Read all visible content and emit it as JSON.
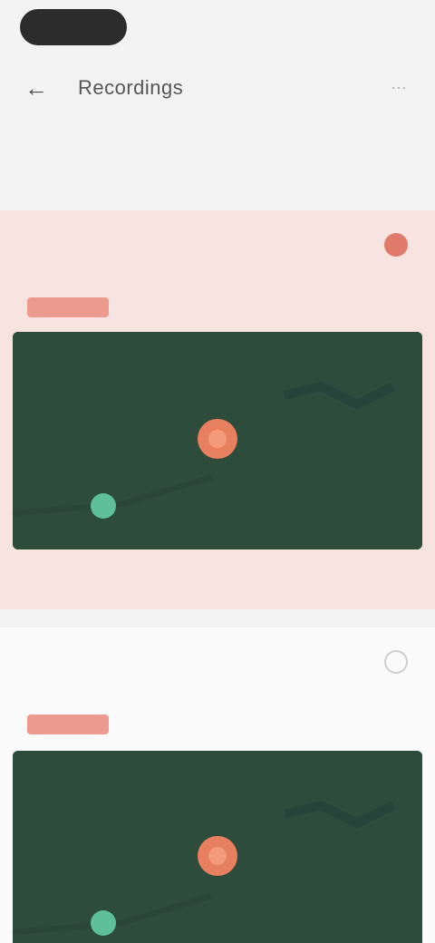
{
  "header": {
    "title": "Recordings",
    "back_icon": "back-arrow-icon",
    "more_icon": "more-icon"
  },
  "subtitle": "",
  "cards": [
    {
      "name": "",
      "meta_left": "",
      "meta_right": "",
      "tag": "",
      "status": "active",
      "map_icon": "location-pin-icon",
      "footer_left": "",
      "footer_right": "",
      "accent": "#e07a6b"
    },
    {
      "name": "",
      "meta_left": "",
      "meta_right": "",
      "tag": "",
      "status": "inactive",
      "map_icon": "location-pin-icon",
      "accent": "#cfcfcf"
    }
  ],
  "colors": {
    "map_bg": "#2e4c3c",
    "marker": "#e87f5e",
    "start_marker": "#5fbf9a",
    "card_active_bg": "#f7e4e1"
  }
}
